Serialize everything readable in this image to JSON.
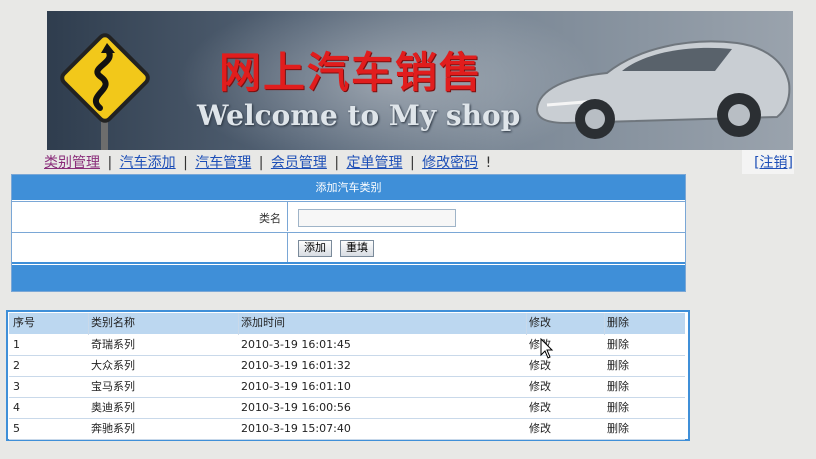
{
  "banner": {
    "title": "网上汽车销售",
    "subtitle": "Welcome to My shop"
  },
  "nav": {
    "items": [
      {
        "label": "类别管理"
      },
      {
        "label": "汽车添加"
      },
      {
        "label": "汽车管理"
      },
      {
        "label": "会员管理"
      },
      {
        "label": "定单管理"
      },
      {
        "label": "修改密码"
      }
    ],
    "separator": "|",
    "trailing": "!",
    "logout": "[注销]"
  },
  "form": {
    "title": "添加汽车类别",
    "name_label": "类名",
    "name_value": "",
    "add_label": "添加",
    "reset_label": "重填"
  },
  "table": {
    "headers": [
      "序号",
      "类别名称",
      "添加时间",
      "修改",
      "删除"
    ],
    "rows": [
      {
        "id": "1",
        "name": "奇瑞系列",
        "time": "2010-3-19 16:01:45",
        "edit": "修改",
        "delete": "删除"
      },
      {
        "id": "2",
        "name": "大众系列",
        "time": "2010-3-19 16:01:32",
        "edit": "修改",
        "delete": "删除"
      },
      {
        "id": "3",
        "name": "宝马系列",
        "time": "2010-3-19 16:01:10",
        "edit": "修改",
        "delete": "删除"
      },
      {
        "id": "4",
        "name": "奥迪系列",
        "time": "2010-3-19 16:00:56",
        "edit": "修改",
        "delete": "删除"
      },
      {
        "id": "5",
        "name": "奔驰系列",
        "time": "2010-3-19 15:07:40",
        "edit": "修改",
        "delete": "删除"
      }
    ]
  },
  "colors": {
    "accent": "#3f8fd8",
    "header_bg": "#bcd7f0",
    "link": "#1e4fb7",
    "title_red": "#e11d1d"
  }
}
